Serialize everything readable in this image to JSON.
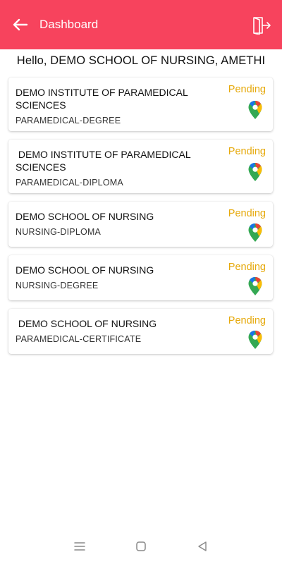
{
  "header": {
    "title": "Dashboard",
    "back_icon": "arrow-left-icon",
    "logout_icon": "logout-door-icon",
    "background": "#f7435d"
  },
  "greeting": "Hello, DEMO SCHOOL OF NURSING, AMETHI",
  "status_color": "#e6a90b",
  "institutes": [
    {
      "name": "DEMO INSTITUTE OF PARAMEDICAL SCIENCES",
      "course": "PARAMEDICAL-DEGREE",
      "status": "Pending"
    },
    {
      "name": " DEMO INSTITUTE OF PARAMEDICAL SCIENCES",
      "course": "PARAMEDICAL-DIPLOMA",
      "status": "Pending"
    },
    {
      "name": "DEMO SCHOOL OF NURSING",
      "course": "NURSING-DIPLOMA",
      "status": "Pending"
    },
    {
      "name": "DEMO SCHOOL OF NURSING",
      "course": "NURSING-DEGREE",
      "status": "Pending"
    },
    {
      "name": " DEMO SCHOOL OF NURSING",
      "course": "PARAMEDICAL-CERTIFICATE",
      "status": "Pending"
    }
  ],
  "system_nav": [
    "menu-icon",
    "home-icon",
    "back-triangle-icon"
  ]
}
